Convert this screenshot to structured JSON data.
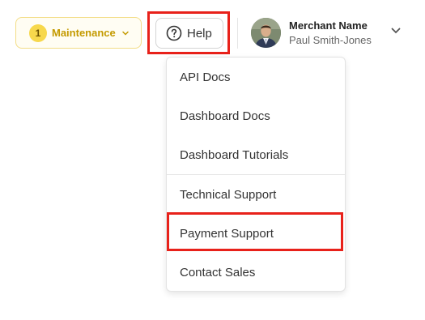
{
  "maintenance": {
    "count": "1",
    "label": "Maintenance",
    "icon": "chevron-down-icon"
  },
  "help": {
    "label": "Help",
    "icon": "question-circle-icon"
  },
  "account": {
    "name": "Merchant Name",
    "user": "Paul Smith-Jones",
    "icon": "chevron-down-icon"
  },
  "help_menu": {
    "items": [
      {
        "label": "API Docs"
      },
      {
        "label": "Dashboard Docs"
      },
      {
        "label": "Dashboard Tutorials"
      },
      {
        "label": "Technical Support"
      },
      {
        "label": "Payment Support"
      },
      {
        "label": "Contact Sales"
      }
    ]
  },
  "colors": {
    "highlight": "#e8211a",
    "maintenance_accent": "#c49a00",
    "badge": "#f7d84c"
  }
}
